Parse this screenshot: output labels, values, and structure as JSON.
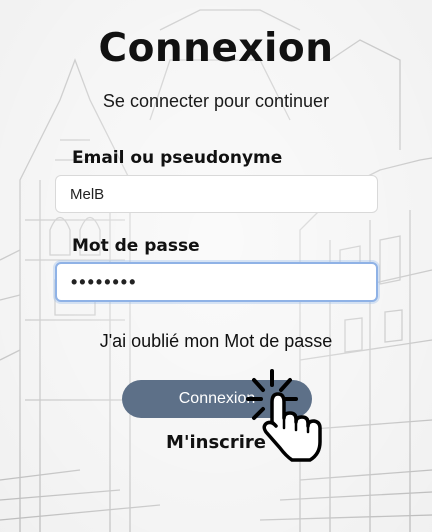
{
  "page": {
    "title": "Connexion",
    "subtitle": "Se connecter pour continuer"
  },
  "form": {
    "email_label": "Email ou pseudonyme",
    "email_value": "MelB",
    "password_label": "Mot de passe",
    "password_value": "••••••••",
    "forgot_link": "J'ai oublié mon Mot de passe",
    "submit_label": "Connexion",
    "register_link": "M'inscrire"
  },
  "colors": {
    "button_bg": "#5d7088",
    "focus_border": "#8fb2e6",
    "text": "#111111"
  },
  "icons": {
    "cursor": "hand-pointer-click-icon"
  }
}
